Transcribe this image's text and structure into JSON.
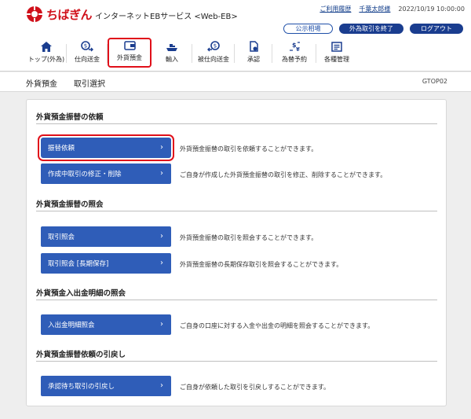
{
  "header": {
    "logo_text": "ちばぎん",
    "service_name": "インターネットEBサービス <Web-EB>",
    "help_link": "ご利用履歴",
    "user_name": "千葉太郎様",
    "datetime": "2022/10/19 10:00:00",
    "buttons": {
      "public_rates": "公示相場",
      "end_fx": "外為取引を終了",
      "logout": "ログアウト"
    }
  },
  "nav": {
    "items": [
      {
        "label": "トップ(外為)",
        "icon": "home-icon"
      },
      {
        "label": "仕向送金",
        "icon": "outgoing-remittance-icon"
      },
      {
        "label": "外貨預金",
        "icon": "fx-deposit-icon",
        "active": true
      },
      {
        "label": "輸入",
        "icon": "import-icon"
      },
      {
        "label": "被仕向送金",
        "icon": "incoming-remittance-icon"
      },
      {
        "label": "承認",
        "icon": "approval-icon"
      },
      {
        "label": "為替予約",
        "icon": "fx-contract-icon"
      },
      {
        "label": "各種管理",
        "icon": "management-icon"
      }
    ]
  },
  "titlebar": {
    "section": "外貨預金",
    "page": "取引選択",
    "screen_id": "GTOP02"
  },
  "sections": [
    {
      "title": "外貨預金振替の依頼",
      "actions": [
        {
          "label": "振替依頼",
          "desc": "外貨預金振替の取引を依頼することができます。",
          "highlight": true
        },
        {
          "label": "作成中取引の修正・削除",
          "desc": "ご自身が作成した外貨預金振替の取引を修正、削除することができます。"
        }
      ]
    },
    {
      "title": "外貨預金振替の照会",
      "actions": [
        {
          "label": "取引照会",
          "desc": "外貨預金振替の取引を照会することができます。"
        },
        {
          "label": "取引照会 [長期保存]",
          "desc": "外貨預金振替の長期保存取引を照会することができます。"
        }
      ]
    },
    {
      "title": "外貨預金入出金明細の照会",
      "actions": [
        {
          "label": "入出金明細照会",
          "desc": "ご自身の口座に対する入金や出金の明細を照会することができます。"
        }
      ]
    },
    {
      "title": "外貨預金振替依頼の引戻し",
      "actions": [
        {
          "label": "承認待ち取引の引戻し",
          "desc": "ご自身が依頼した取引を引戻しすることができます。"
        }
      ]
    }
  ],
  "colors": {
    "brand_red": "#d0101a",
    "action_blue": "#2f5db8",
    "nav_icon_blue": "#1a3d8f"
  }
}
